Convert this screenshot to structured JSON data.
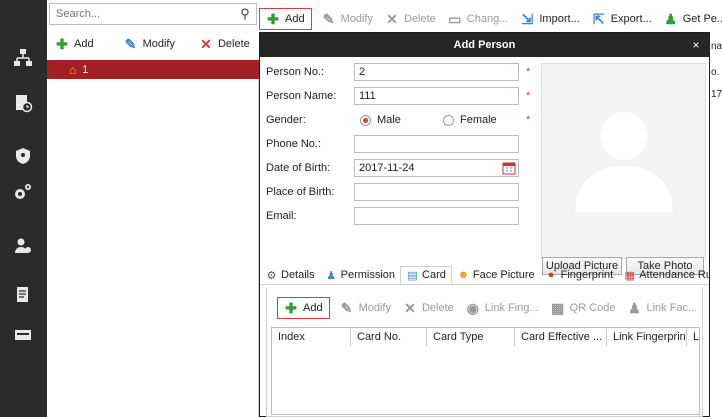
{
  "search": {
    "placeholder": "Search..."
  },
  "org_toolbar": {
    "add": "Add",
    "modify": "Modify",
    "delete": "Delete"
  },
  "tree": {
    "node": "1"
  },
  "person_toolbar": {
    "add": "Add",
    "modify": "Modify",
    "delete": "Delete",
    "change": "Chang...",
    "import": "Import...",
    "export": "Export...",
    "get": "Get Pe..."
  },
  "dialog": {
    "title": "Add Person",
    "close": "×",
    "labels": {
      "person_no": "Person No.:",
      "person_name": "Person Name:",
      "gender": "Gender:",
      "phone": "Phone No.:",
      "dob": "Date of Birth:",
      "pob": "Place of Birth:",
      "email": "Email:"
    },
    "values": {
      "person_no": "2",
      "person_name": "111",
      "phone": "",
      "dob": "2017-11-24",
      "pob": "",
      "email": ""
    },
    "required_mark": "*",
    "gender_options": {
      "male": "Male",
      "female": "Female",
      "selected": "Male"
    },
    "upload_picture": "Upload Picture",
    "take_photo": "Take Photo",
    "tabs": [
      "Details",
      "Permission",
      "Card",
      "Face Picture",
      "Fingerprint",
      "Attendance Rule"
    ],
    "active_tab": "Card",
    "card_toolbar": {
      "add": "Add",
      "modify": "Modify",
      "delete": "Delete",
      "link_fingerprint": "Link Fing...",
      "qr_code": "QR Code",
      "link_face": "Link Fac..."
    },
    "card_columns": [
      "Index",
      "Card No.",
      "Card Type",
      "Card Effective ...",
      "Link Fingerprint",
      "Li"
    ]
  },
  "right_strip": {
    "line1": "na",
    "line2": "o.",
    "line3": "17"
  },
  "colors": {
    "accent_red": "#a31f24",
    "sidebar_bg": "#2b2b2b",
    "dialog_title_bg": "#262626",
    "add_green": "#2e9d2e"
  }
}
